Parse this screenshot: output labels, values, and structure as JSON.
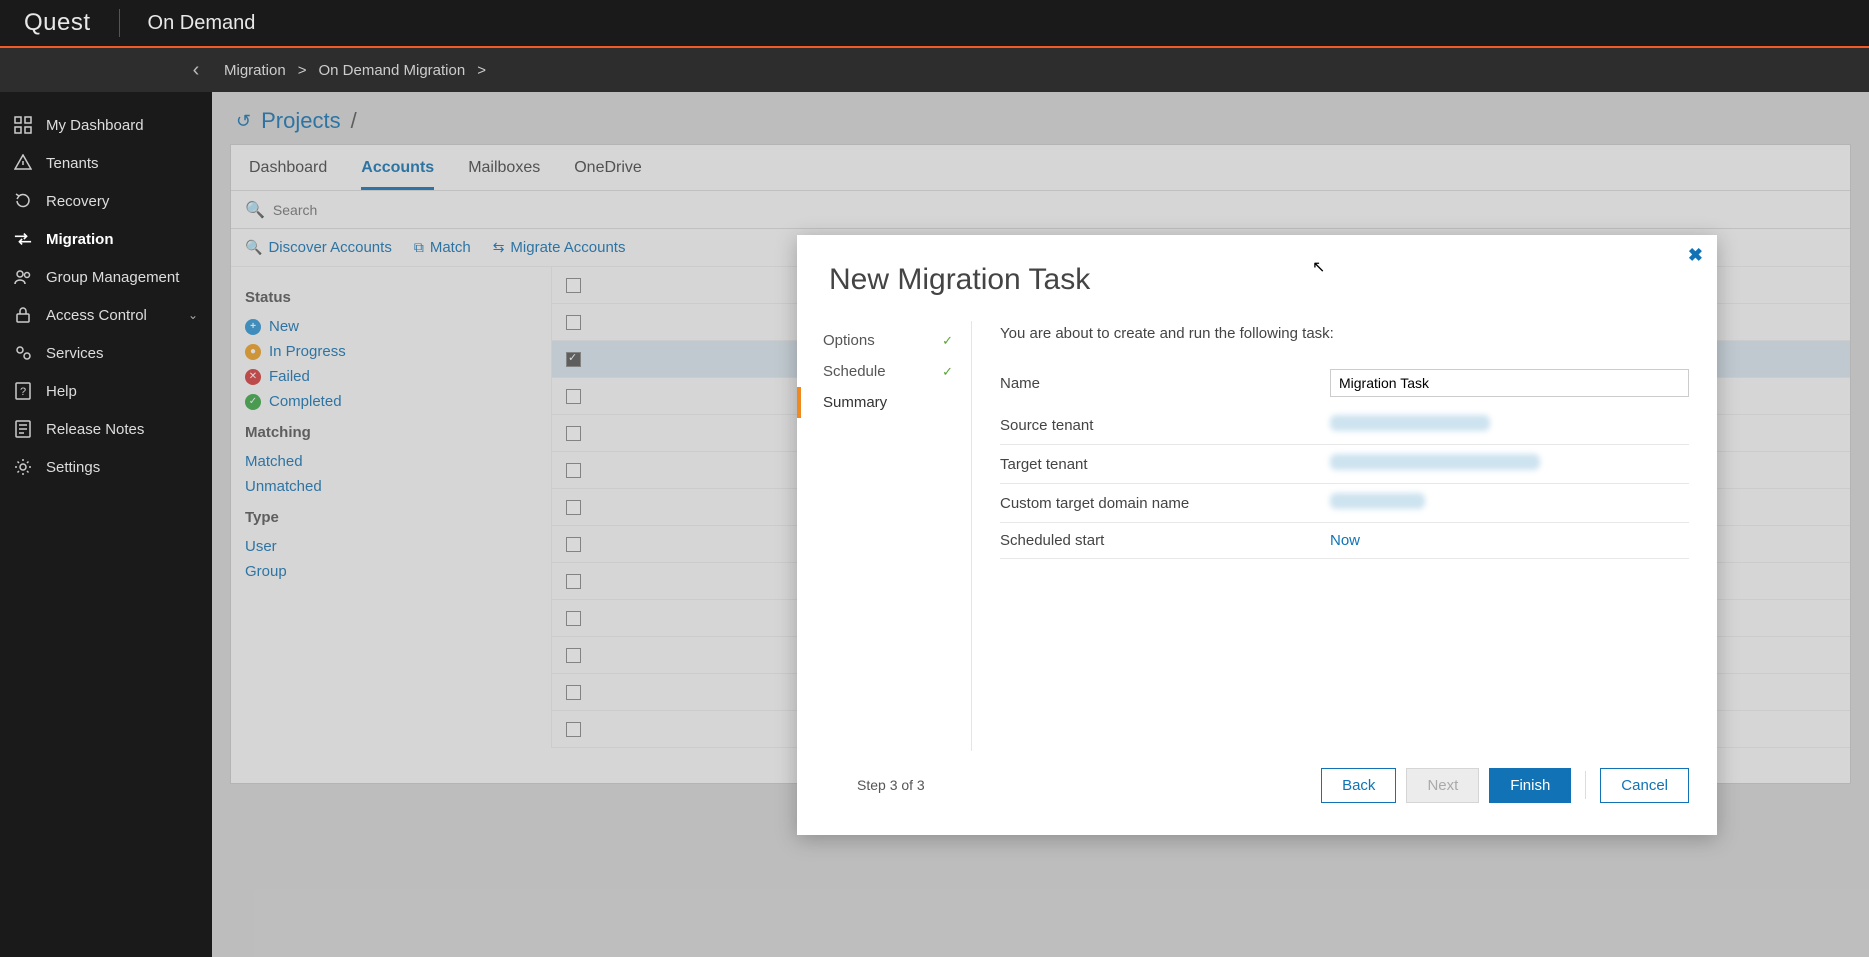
{
  "header": {
    "logo": "Quest",
    "app": "On Demand"
  },
  "breadcrumb": {
    "items": [
      "Migration",
      "On Demand Migration"
    ]
  },
  "sidebar": {
    "items": [
      {
        "label": "My Dashboard"
      },
      {
        "label": "Tenants"
      },
      {
        "label": "Recovery"
      },
      {
        "label": "Migration"
      },
      {
        "label": "Group Management"
      },
      {
        "label": "Access Control"
      },
      {
        "label": "Services"
      },
      {
        "label": "Help"
      },
      {
        "label": "Release Notes"
      },
      {
        "label": "Settings"
      }
    ]
  },
  "page": {
    "title": "Projects",
    "slash": "/"
  },
  "tabs": [
    "Dashboard",
    "Accounts",
    "Mailboxes",
    "OneDrive"
  ],
  "search": {
    "placeholder": "Search"
  },
  "actions": {
    "discover": "Discover Accounts",
    "match": "Match",
    "migrate": "Migrate Accounts"
  },
  "filters": {
    "status_head": "Status",
    "status": {
      "new": "New",
      "inprogress": "In Progress",
      "failed": "Failed",
      "completed": "Completed"
    },
    "matching_head": "Matching",
    "matching": {
      "matched": "Matched",
      "unmatched": "Unmatched"
    },
    "type_head": "Type",
    "type": {
      "user": "User",
      "group": "Group"
    }
  },
  "modal": {
    "title": "New Migration Task",
    "steps": {
      "options": "Options",
      "schedule": "Schedule",
      "summary": "Summary"
    },
    "intro": "You are about to create and run the following task:",
    "fields": {
      "name_label": "Name",
      "name_value": "Migration Task",
      "source_label": "Source tenant",
      "target_label": "Target tenant",
      "domain_label": "Custom target domain name",
      "sched_label": "Scheduled start",
      "sched_value": "Now"
    },
    "step_indicator": "Step 3 of 3",
    "buttons": {
      "back": "Back",
      "next": "Next",
      "finish": "Finish",
      "cancel": "Cancel"
    }
  }
}
